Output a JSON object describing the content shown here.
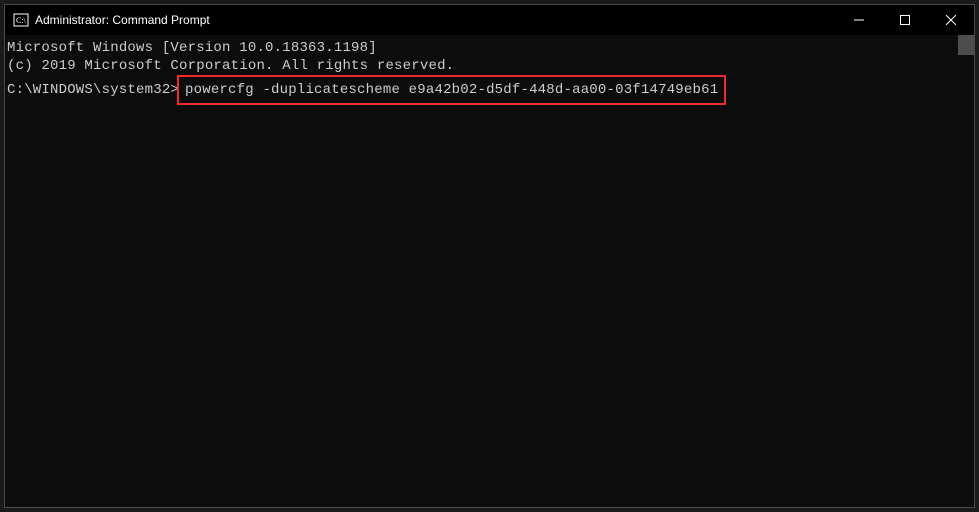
{
  "titlebar": {
    "title": "Administrator: Command Prompt"
  },
  "terminal": {
    "line1": "Microsoft Windows [Version 10.0.18363.1198]",
    "line2": "(c) 2019 Microsoft Corporation. All rights reserved.",
    "blank": "",
    "prompt": "C:\\WINDOWS\\system32>",
    "command": "powercfg -duplicatescheme e9a42b02-d5df-448d-aa00-03f14749eb61"
  },
  "highlight_color": "#ed2b2b"
}
